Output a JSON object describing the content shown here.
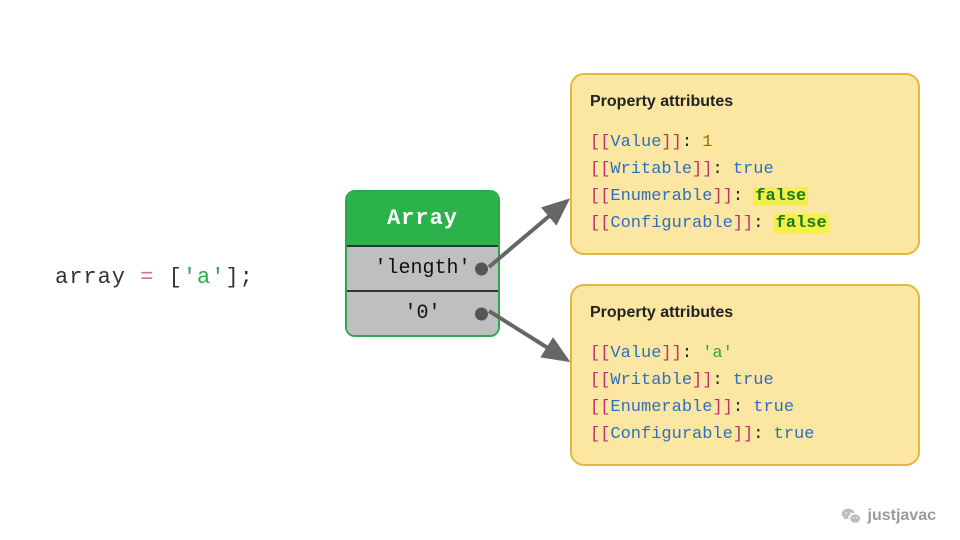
{
  "code": {
    "identifier": "array",
    "equals": "=",
    "open_bracket": "[",
    "string_literal": "'a'",
    "close_bracket": "]",
    "semicolon": ";"
  },
  "array_object": {
    "header": "Array",
    "cells": [
      {
        "label": "'length'"
      },
      {
        "label": "'0'"
      }
    ]
  },
  "cards": [
    {
      "title": "Property attributes",
      "lines": [
        {
          "name": "Value",
          "value": "1",
          "value_kind": "number"
        },
        {
          "name": "Writable",
          "value": "true",
          "value_kind": "true"
        },
        {
          "name": "Enumerable",
          "value": "false",
          "value_kind": "false"
        },
        {
          "name": "Configurable",
          "value": "false",
          "value_kind": "false"
        }
      ]
    },
    {
      "title": "Property attributes",
      "lines": [
        {
          "name": "Value",
          "value": "'a'",
          "value_kind": "string"
        },
        {
          "name": "Writable",
          "value": "true",
          "value_kind": "true"
        },
        {
          "name": "Enumerable",
          "value": "true",
          "value_kind": "true"
        },
        {
          "name": "Configurable",
          "value": "true",
          "value_kind": "true"
        }
      ]
    }
  ],
  "watermark": {
    "text": "justjavac"
  }
}
